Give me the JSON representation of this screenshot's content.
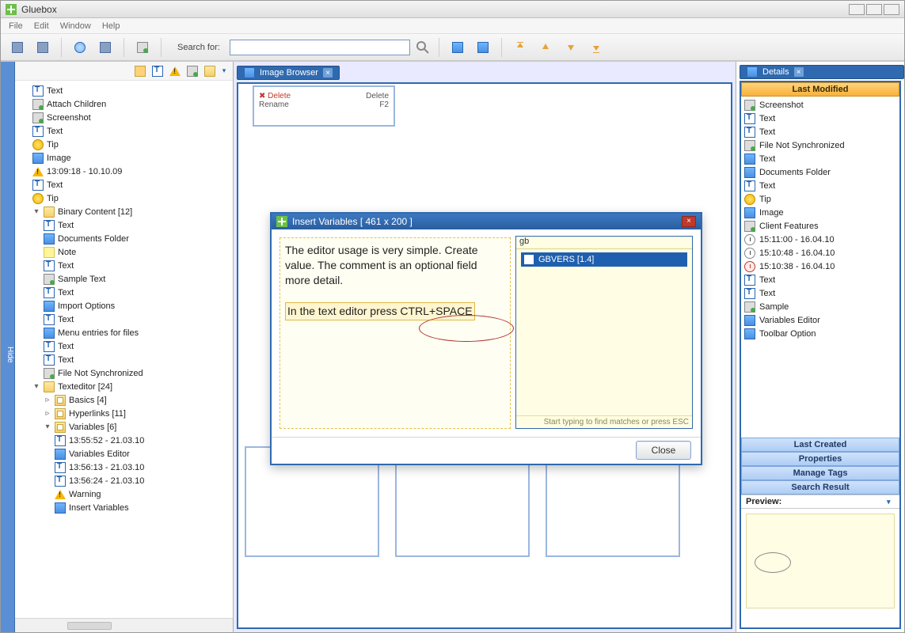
{
  "app": {
    "title": "Gluebox"
  },
  "menu": {
    "file": "File",
    "edit": "Edit",
    "window": "Window",
    "help": "Help"
  },
  "toolbar": {
    "search_label": "Search for:",
    "search_value": ""
  },
  "sidebar": {
    "hide": "Hide",
    "items": [
      {
        "icon": "text",
        "label": "Text"
      },
      {
        "icon": "scr",
        "label": "Attach Children"
      },
      {
        "icon": "scr",
        "label": "Screenshot"
      },
      {
        "icon": "text",
        "label": "Text"
      },
      {
        "icon": "tip",
        "label": "Tip"
      },
      {
        "icon": "img",
        "label": "Image"
      },
      {
        "icon": "warn",
        "label": "13:09:18 - 10.10.09"
      },
      {
        "icon": "text",
        "label": "Text"
      },
      {
        "icon": "tip",
        "label": "Tip"
      }
    ],
    "binary": {
      "label": "Binary Content [12]",
      "items": [
        {
          "icon": "text",
          "label": "Text"
        },
        {
          "icon": "img",
          "label": "Documents Folder"
        },
        {
          "icon": "note",
          "label": "Note"
        },
        {
          "icon": "text",
          "label": "Text"
        },
        {
          "icon": "scr",
          "label": "Sample Text"
        },
        {
          "icon": "text",
          "label": "Text"
        },
        {
          "icon": "img",
          "label": "Import Options"
        },
        {
          "icon": "text",
          "label": "Text"
        },
        {
          "icon": "img",
          "label": "Menu entries for files"
        },
        {
          "icon": "text",
          "label": "Text"
        },
        {
          "icon": "text",
          "label": "Text"
        },
        {
          "icon": "scr",
          "label": "File Not Synchronized"
        }
      ]
    },
    "texteditor": {
      "label": "Texteditor [24]",
      "children": [
        {
          "icon": "foldm",
          "label": "Basics [4]",
          "expand": "▹"
        },
        {
          "icon": "foldm",
          "label": "Hyperlinks [11]",
          "expand": "▹"
        },
        {
          "icon": "foldm",
          "label": "Variables [6]",
          "expand": "▿",
          "items": [
            {
              "icon": "text",
              "label": "13:55:52 - 21.03.10"
            },
            {
              "icon": "img",
              "label": "Variables Editor"
            },
            {
              "icon": "text",
              "label": "13:56:13 - 21.03.10"
            },
            {
              "icon": "text",
              "label": "13:56:24 - 21.03.10"
            },
            {
              "icon": "warn",
              "label": "Warning"
            },
            {
              "icon": "img",
              "label": "Insert Variables"
            }
          ]
        }
      ]
    }
  },
  "center": {
    "tab": "Image Browser",
    "topcard": {
      "del_label": "Delete",
      "del_key": "Delete",
      "ren_label": "Rename",
      "ren_key": "F2"
    }
  },
  "dialog": {
    "title": "Insert Variables  [ 461 x 200 ]",
    "body_line1": "The editor usage is very simple. Create",
    "body_line2": "value. The comment is an optional field",
    "body_line3": "more detail.",
    "body_line4": "In the text editor press",
    "ctrl_space": "CTRL+SPACE",
    "popup_input": "gb",
    "popup_item": "GBVERS [1.4]",
    "popup_hint": "Start typing to find matches or press ESC",
    "close": "Close"
  },
  "details": {
    "tab": "Details",
    "header_lastmod": "Last Modified",
    "items": [
      {
        "icon": "scr",
        "label": "Screenshot"
      },
      {
        "icon": "text",
        "label": "Text"
      },
      {
        "icon": "text",
        "label": "Text"
      },
      {
        "icon": "scr",
        "label": "File Not Synchronized"
      },
      {
        "icon": "img",
        "label": "Text"
      },
      {
        "icon": "img",
        "label": "Documents Folder"
      },
      {
        "icon": "text",
        "label": "Text"
      },
      {
        "icon": "tip",
        "label": "Tip"
      },
      {
        "icon": "img",
        "label": "Image"
      },
      {
        "icon": "scr",
        "label": "Client Features"
      },
      {
        "icon": "clock",
        "label": "15:11:00 - 16.04.10"
      },
      {
        "icon": "clock",
        "label": "15:10:48 - 16.04.10"
      },
      {
        "icon": "clockr",
        "label": "15:10:38 - 16.04.10"
      },
      {
        "icon": "text",
        "label": "Text"
      },
      {
        "icon": "text",
        "label": "Text"
      },
      {
        "icon": "scr",
        "label": "Sample"
      },
      {
        "icon": "img",
        "label": "Variables Editor"
      },
      {
        "icon": "img",
        "label": "Toolbar Option"
      }
    ],
    "acc_lastcreated": "Last Created",
    "acc_properties": "Properties",
    "acc_tags": "Manage Tags",
    "acc_search": "Search Result",
    "preview": "Preview:"
  }
}
